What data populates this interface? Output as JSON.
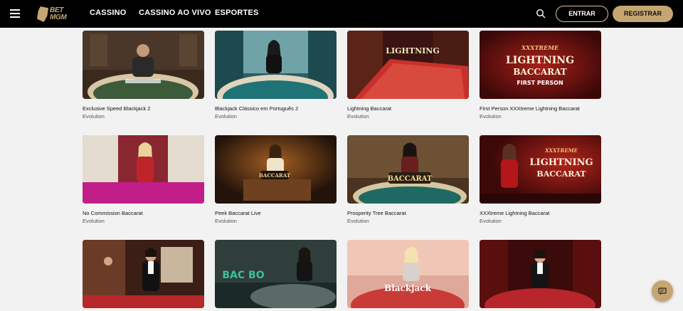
{
  "header": {
    "brand": "BETMGM",
    "brand_line1": "BET",
    "brand_line2": "MGM",
    "nav": [
      "CASSINO",
      "CASSINO AO VIVO",
      "ESPORTES"
    ],
    "login_label": "ENTRAR",
    "register_label": "REGISTRAR"
  },
  "colors": {
    "brand_gold": "#c5a572",
    "header_bg": "#000000",
    "page_bg": "#f2f2f2"
  },
  "games": [
    {
      "title": "Exclusive Speed Blackjack 2",
      "provider": "Evolution",
      "overlay": ""
    },
    {
      "title": "Blackjack Clássico em Português 2",
      "provider": "Evolution",
      "overlay": ""
    },
    {
      "title": "Lightning Baccarat",
      "provider": "Evolution",
      "overlay": "LIGHTNING"
    },
    {
      "title": "First Person XXXtreme Lightning Baccarat",
      "provider": "Evolution",
      "overlay": "LIGHTNING"
    },
    {
      "title": "No Commission Baccarat",
      "provider": "Evolution",
      "overlay": ""
    },
    {
      "title": "Peek Baccarat Live",
      "provider": "Evolution",
      "overlay": "BACCARAT"
    },
    {
      "title": "Prosperity Tree Baccarat",
      "provider": "Evolution",
      "overlay": "BACCARAT"
    },
    {
      "title": "XXXtreme Lightning Baccarat",
      "provider": "Evolution",
      "overlay": "LIGHTNING"
    },
    {
      "title": "",
      "provider": "",
      "overlay": ""
    },
    {
      "title": "",
      "provider": "",
      "overlay": "BAC BO"
    },
    {
      "title": "",
      "provider": "",
      "overlay": "Blackjack"
    },
    {
      "title": "",
      "provider": "",
      "overlay": ""
    }
  ],
  "logo_overlays": {
    "card3_top": "LIGHTNING",
    "card4_top": "XXXTREME",
    "card4_mid": "LIGHTNING",
    "card4_bot": "BACCARAT",
    "card4_fp": "FIRST PERSON",
    "card8_top": "XXXTREME",
    "card8_mid": "LIGHTNING",
    "card8_bot": "BACCARAT"
  },
  "icons": {
    "menu": "hamburger-menu-icon",
    "search": "search-icon",
    "chat": "chat-icon"
  }
}
